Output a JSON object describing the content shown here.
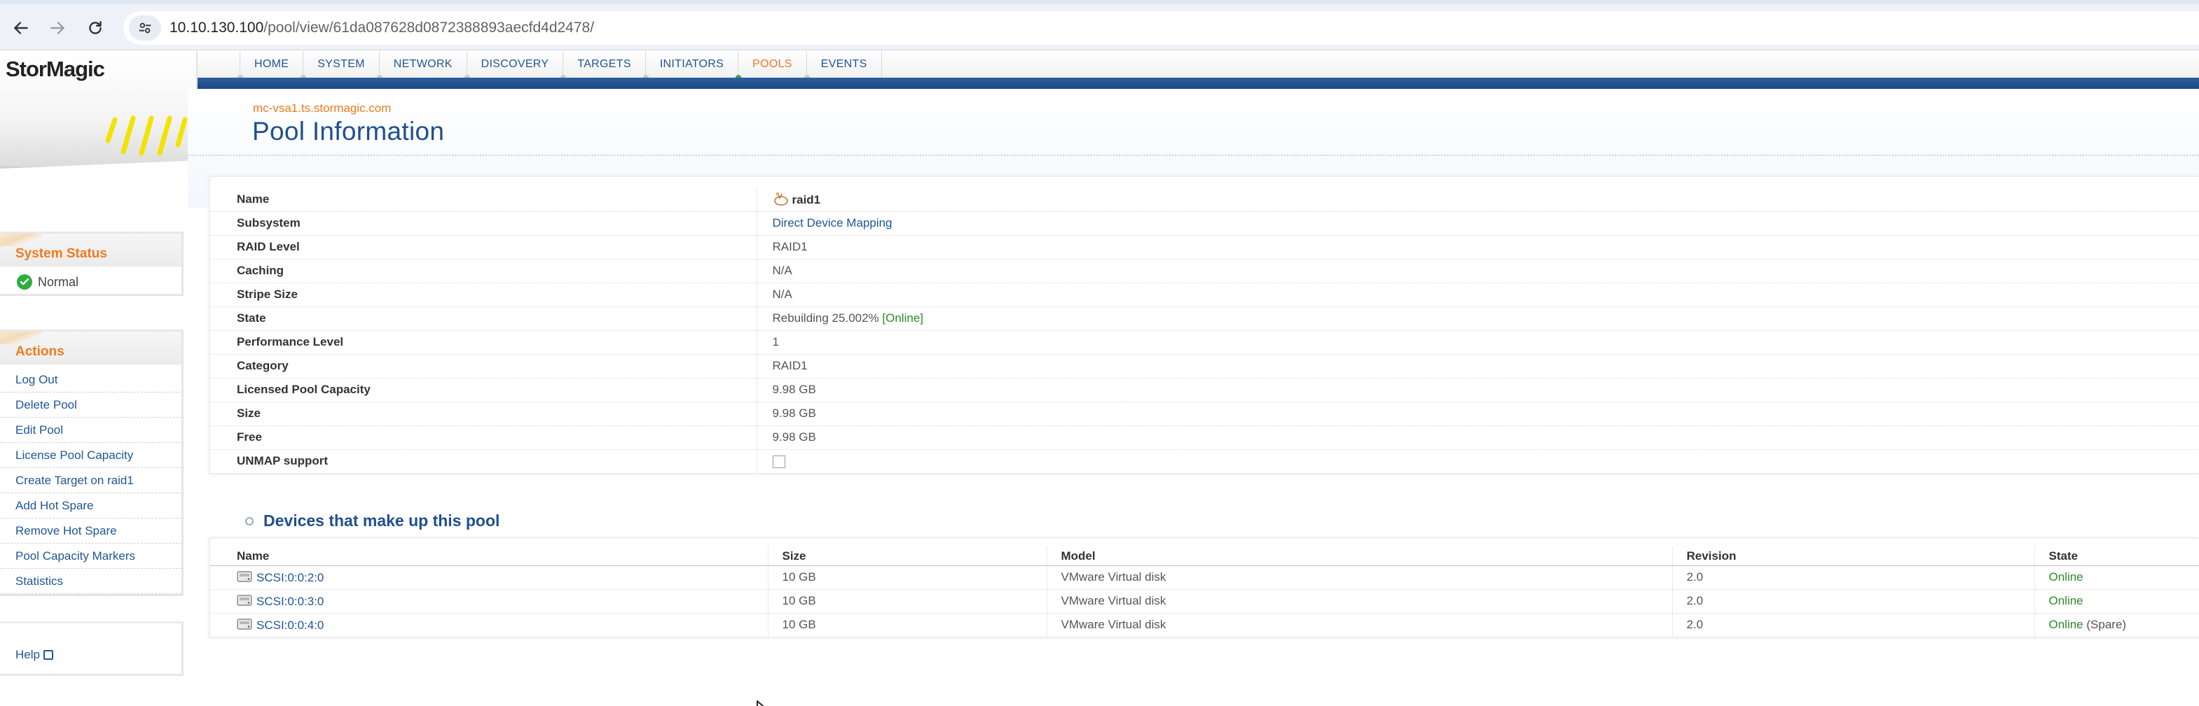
{
  "browser": {
    "url_host": "10.10.130.100",
    "url_path": "/pool/view/61da087628d0872388893aecfd4d2478/"
  },
  "brand": {
    "name": "StorMagic"
  },
  "nav": {
    "tabs": [
      {
        "label": "HOME",
        "active": false
      },
      {
        "label": "SYSTEM",
        "active": false
      },
      {
        "label": "NETWORK",
        "active": false
      },
      {
        "label": "DISCOVERY",
        "active": false
      },
      {
        "label": "TARGETS",
        "active": false
      },
      {
        "label": "INITIATORS",
        "active": false
      },
      {
        "label": "POOLS",
        "active": true
      },
      {
        "label": "EVENTS",
        "active": false
      }
    ]
  },
  "header": {
    "hostname": "mc-vsa1.ts.stormagic.com",
    "title": "Pool Information"
  },
  "sidebar": {
    "status_title": "System Status",
    "status_text": "Normal",
    "actions_title": "Actions",
    "actions": [
      "Log Out",
      "Delete Pool",
      "Edit Pool",
      "License Pool Capacity",
      "Create Target on raid1",
      "Add Hot Spare",
      "Remove Hot Spare",
      "Pool Capacity Markers",
      "Statistics"
    ],
    "help": "Help"
  },
  "info": {
    "rows": [
      {
        "key": "Name",
        "value": "raid1"
      },
      {
        "key": "Subsystem",
        "value": "Direct Device Mapping"
      },
      {
        "key": "RAID Level",
        "value": "RAID1"
      },
      {
        "key": "Caching",
        "value": "N/A"
      },
      {
        "key": "Stripe Size",
        "value": "N/A"
      },
      {
        "key": "State",
        "value": "Rebuilding 25.002%",
        "value2": "[Online]"
      },
      {
        "key": "Performance Level",
        "value": "1"
      },
      {
        "key": "Category",
        "value": "RAID1"
      },
      {
        "key": "Licensed Pool Capacity",
        "value": "9.98 GB"
      },
      {
        "key": "Size",
        "value": "9.98 GB"
      },
      {
        "key": "Free",
        "value": "9.98 GB"
      },
      {
        "key": "UNMAP support",
        "value": ""
      }
    ],
    "unmap_checked": false
  },
  "devices": {
    "heading": "Devices that make up this pool",
    "columns": [
      "Name",
      "Size",
      "Model",
      "Revision",
      "State"
    ],
    "rows": [
      {
        "name": "SCSI:0:0:2:0",
        "size": "10 GB",
        "model": "VMware Virtual disk",
        "revision": "2.0",
        "state": "Online",
        "extra": ""
      },
      {
        "name": "SCSI:0:0:3:0",
        "size": "10 GB",
        "model": "VMware Virtual disk",
        "revision": "2.0",
        "state": "Online",
        "extra": ""
      },
      {
        "name": "SCSI:0:0:4:0",
        "size": "10 GB",
        "model": "VMware Virtual disk",
        "revision": "2.0",
        "state": "Online",
        "extra": "(Spare)"
      }
    ]
  },
  "colors": {
    "accent_orange": "#f07a1e",
    "link_blue": "#1f5597",
    "band_blue": "#1a4784",
    "status_green": "#2c8a2c"
  }
}
